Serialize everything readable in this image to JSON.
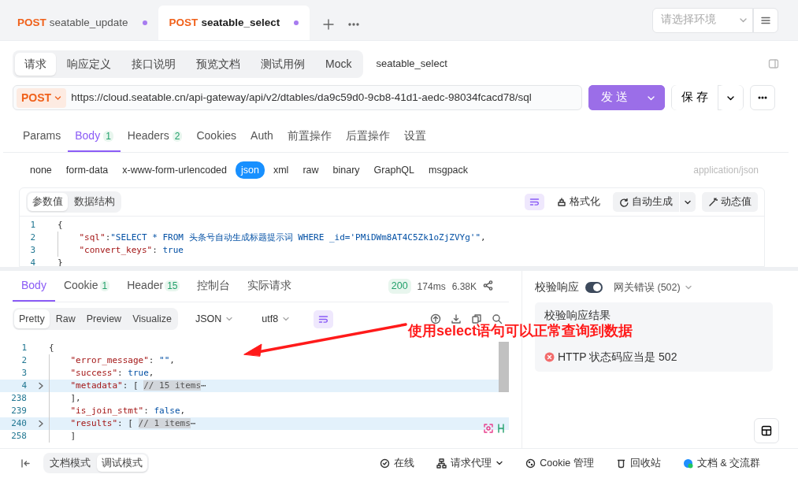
{
  "file_tabs": [
    {
      "method": "POST",
      "name": "seatable_update",
      "selected": false,
      "unsaved": true
    },
    {
      "method": "POST",
      "name": "seatable_select",
      "selected": true,
      "unsaved": true
    }
  ],
  "environment": {
    "placeholder": "请选择环境"
  },
  "mode_tabs": [
    {
      "label": "请求",
      "selected": true
    },
    {
      "label": "响应定义",
      "selected": false
    },
    {
      "label": "接口说明",
      "selected": false
    },
    {
      "label": "预览文档",
      "selected": false
    },
    {
      "label": "测试用例",
      "selected": false
    },
    {
      "label": "Mock",
      "selected": false
    }
  ],
  "api_name": "seatable_select",
  "request": {
    "method": "POST",
    "url": "https://cloud.seatable.cn/api-gateway/api/v2/dtables/da9c59d0-9cb8-41d1-aedc-98034fcacd78/sql",
    "send": "发 送",
    "save": "保 存"
  },
  "request_tabs": [
    {
      "label": "Params",
      "selected": false
    },
    {
      "label": "Body",
      "count": "1",
      "selected": true
    },
    {
      "label": "Headers",
      "count": "2",
      "selected": false
    },
    {
      "label": "Cookies",
      "selected": false
    },
    {
      "label": "Auth",
      "selected": false
    },
    {
      "label": "前置操作",
      "selected": false
    },
    {
      "label": "后置操作",
      "selected": false
    },
    {
      "label": "设置",
      "selected": false
    }
  ],
  "body_types": [
    {
      "label": "none",
      "selected": false
    },
    {
      "label": "form-data",
      "selected": false
    },
    {
      "label": "x-www-form-urlencoded",
      "selected": false
    },
    {
      "label": "json",
      "selected": true
    },
    {
      "label": "xml",
      "selected": false
    },
    {
      "label": "raw",
      "selected": false
    },
    {
      "label": "binary",
      "selected": false
    },
    {
      "label": "GraphQL",
      "selected": false
    },
    {
      "label": "msgpack",
      "selected": false
    }
  ],
  "content_type": "application/json",
  "editor": {
    "view_tabs": [
      {
        "label": "参数值",
        "selected": true
      },
      {
        "label": "数据结构",
        "selected": false
      }
    ],
    "format": "格式化",
    "auto_generate": "自动生成",
    "dynamic_value": "动态值",
    "lines": [
      {
        "number": "1",
        "code": "{"
      },
      {
        "number": "2",
        "code": "    \"sql\":\"SELECT * FROM 头条号自动生成标题提示词 WHERE _id='PMiDWm8AT4C5Zk1oZjZVYg'\","
      },
      {
        "number": "3",
        "code": "    \"convert_keys\": true"
      },
      {
        "number": "4",
        "code": "}"
      }
    ]
  },
  "response": {
    "tabs": [
      {
        "label": "Body",
        "selected": true
      },
      {
        "label": "Cookie",
        "count": "1",
        "selected": false
      },
      {
        "label": "Header",
        "count": "15",
        "selected": false
      },
      {
        "label": "控制台",
        "selected": false
      },
      {
        "label": "实际请求",
        "selected": false
      }
    ],
    "status": "200",
    "time": "174ms",
    "size": "6.38K",
    "format_tabs": [
      {
        "label": "Pretty",
        "selected": true
      },
      {
        "label": "Raw",
        "selected": false
      },
      {
        "label": "Preview",
        "selected": false
      },
      {
        "label": "Visualize",
        "selected": false
      }
    ],
    "language": "JSON",
    "encoding": "utf8",
    "lines": [
      {
        "number": "1",
        "code": "{",
        "folded": false
      },
      {
        "number": "2",
        "code": "    \"error_message\": \"\",",
        "folded": false
      },
      {
        "number": "3",
        "code": "    \"success\": true,",
        "folded": false
      },
      {
        "number": "4",
        "code": "    \"metadata\": [",
        "folded": true,
        "summary": "// 15 items",
        "ellipsis": "⋯"
      },
      {
        "number": "238",
        "code": "    ],",
        "folded": false
      },
      {
        "number": "239",
        "code": "    \"is_join_stmt\": false,",
        "folded": false
      },
      {
        "number": "240",
        "code": "    \"results\": [",
        "folded": true,
        "summary": "// 1 items",
        "ellipsis": "⋯"
      },
      {
        "number": "258",
        "code": "    ]",
        "folded": false
      }
    ]
  },
  "validation": {
    "label": "校验响应",
    "on": true,
    "expected": "网关错误 (502)",
    "result_title": "校验响应结果",
    "results": [
      {
        "text": "HTTP 状态码应当是 502",
        "passed": false
      }
    ]
  },
  "annotation": {
    "text": "使用select语句可以正常查询到数据"
  },
  "footer": {
    "modes": [
      {
        "label": "文档模式",
        "selected": false
      },
      {
        "label": "调试模式",
        "selected": true
      }
    ],
    "items": [
      {
        "kind": "online",
        "label": "在线"
      },
      {
        "kind": "proxy",
        "label": "请求代理"
      },
      {
        "kind": "cookie",
        "label": "Cookie 管理"
      },
      {
        "kind": "trash",
        "label": "回收站"
      },
      {
        "kind": "docs",
        "label": "文档 & 交流群"
      }
    ]
  }
}
